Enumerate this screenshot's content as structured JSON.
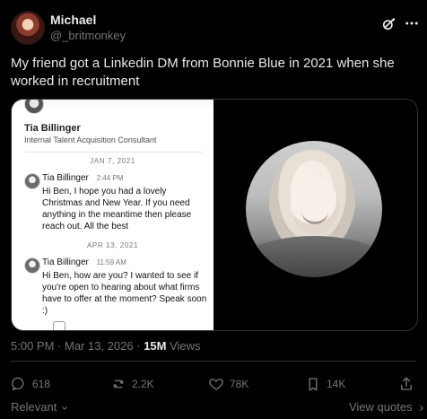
{
  "author": {
    "name": "Michael",
    "handle": "@_britmonkey"
  },
  "tweet": {
    "text": "My friend got a Linkedin DM from Bonnie Blue in 2021 when she worked in recruitment"
  },
  "media": {
    "linkedin": {
      "profile_name": "Tia Billinger",
      "profile_title": "Internal Talent Acquisition Consultant",
      "messages": [
        {
          "date": "JAN 7, 2021",
          "sender": "Tia Billinger",
          "time": "2:44 PM",
          "text": "Hi Ben, I hope you had a lovely Christmas and New Year. If you need anything in the meantime then please reach out. All the best"
        },
        {
          "date": "APR 13, 2021",
          "sender": "Tia Billinger",
          "time": "11:59 AM",
          "text": "Hi Ben, how are you? I wanted to see if you're open to hearing about what firms have to offer at the moment? Speak soon :)"
        }
      ]
    }
  },
  "meta": {
    "time": "5:00 PM",
    "date": "Mar 13, 2026",
    "views_count": "15M",
    "views_label": "Views"
  },
  "actions": {
    "replies": "618",
    "reposts": "2.2K",
    "likes": "78K",
    "bookmarks": "14K"
  },
  "footer": {
    "relevant_label": "Relevant",
    "view_quotes_label": "View quotes"
  },
  "icons": {
    "grok": "grok-icon",
    "more": "more-icon",
    "reply": "reply-icon",
    "repost": "repost-icon",
    "like": "heart-icon",
    "bookmark": "bookmark-icon",
    "share": "share-icon"
  },
  "colors": {
    "background": "#000000",
    "text": "#e7e9ea",
    "muted": "#71767b",
    "border": "#2f3336"
  }
}
